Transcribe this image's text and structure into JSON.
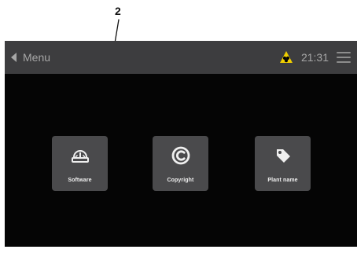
{
  "annotation": {
    "number": "2"
  },
  "header": {
    "back_label": "Menu",
    "time": "21:31",
    "warning_color": "#f0cf00",
    "warning_icon": "warning-triangle-icon",
    "menu_icon": "hamburger-menu-icon"
  },
  "tiles": [
    {
      "label": "Software",
      "icon": "software-gauge-icon"
    },
    {
      "label": "Copyright",
      "icon": "copyright-icon"
    },
    {
      "label": "Plant name",
      "icon": "tag-icon"
    }
  ]
}
